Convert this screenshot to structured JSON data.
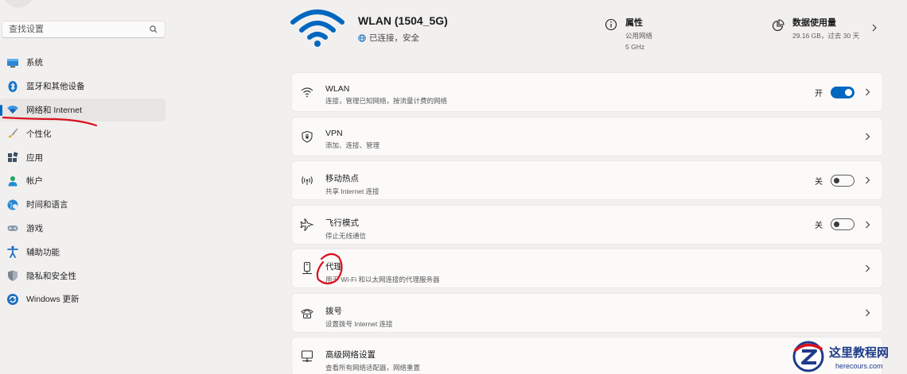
{
  "sidebar": {
    "search_placeholder": "查找设置",
    "items": [
      {
        "label": "系统",
        "icon": "monitor-icon"
      },
      {
        "label": "蓝牙和其他设备",
        "icon": "bluetooth-icon"
      },
      {
        "label": "网络和 Internet",
        "icon": "network-wifi-icon",
        "active": true
      },
      {
        "label": "个性化",
        "icon": "brush-icon"
      },
      {
        "label": "应用",
        "icon": "apps-icon"
      },
      {
        "label": "帐户",
        "icon": "account-icon"
      },
      {
        "label": "时间和语言",
        "icon": "globe-clock-icon"
      },
      {
        "label": "游戏",
        "icon": "gamepad-icon"
      },
      {
        "label": "辅助功能",
        "icon": "accessibility-icon"
      },
      {
        "label": "隐私和安全性",
        "icon": "shield-icon"
      },
      {
        "label": "Windows 更新",
        "icon": "update-icon"
      }
    ]
  },
  "header": {
    "network_name": "WLAN (1504_5G)",
    "status": "已连接，安全",
    "properties": {
      "title": "属性",
      "line1": "公用网络",
      "line2": "5 GHz"
    },
    "data_usage": {
      "title": "数据使用量",
      "detail": "29.16 GB，过去 30 天"
    }
  },
  "cards": [
    {
      "title": "WLAN",
      "desc": "连接，管理已知网络，按流量计费的网络",
      "icon": "wifi-icon",
      "state": "开",
      "toggle_on": true
    },
    {
      "title": "VPN",
      "desc": "添加、连接、管理",
      "icon": "vpn-shield-icon"
    },
    {
      "title": "移动热点",
      "desc": "共享 Internet 连接",
      "icon": "hotspot-icon",
      "state": "关",
      "toggle_on": false
    },
    {
      "title": "飞行模式",
      "desc": "停止无线通信",
      "icon": "airplane-icon",
      "state": "关",
      "toggle_on": false
    },
    {
      "title": "代理",
      "desc": "用于 Wi-Fi 和以太网连接的代理服务器",
      "icon": "proxy-icon"
    },
    {
      "title": "拨号",
      "desc": "设置拨号 Internet 连接",
      "icon": "dialup-icon"
    },
    {
      "title": "高级网络设置",
      "desc": "查看所有网络适配器，网络重置",
      "icon": "advanced-network-icon"
    }
  ],
  "watermark": {
    "name": "这里教程网",
    "url": "herecours.com"
  },
  "colors": {
    "accent": "#0067c0",
    "annotation": "#d8121e",
    "background": "#f2f0ef"
  }
}
